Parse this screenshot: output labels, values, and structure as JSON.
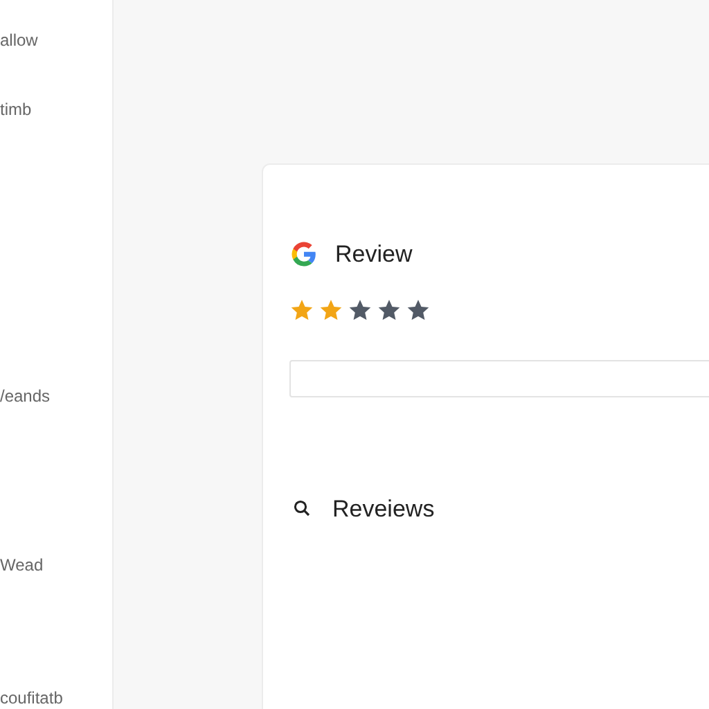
{
  "sidebar": {
    "items": [
      {
        "label": "allow"
      },
      {
        "label": "timb"
      },
      {
        "label": "/eands"
      },
      {
        "label": "Wead"
      },
      {
        "label": "coufitatb"
      }
    ]
  },
  "review_card": {
    "title": "Review",
    "stars": 2,
    "search": {
      "label": "Reveiews"
    }
  }
}
